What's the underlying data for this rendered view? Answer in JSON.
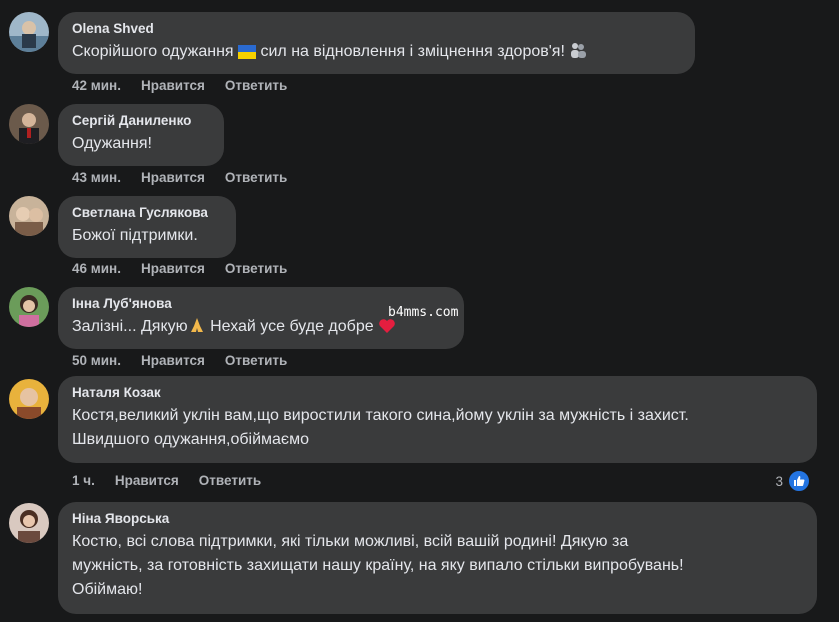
{
  "comments": [
    {
      "author": "Olena Shved",
      "text_a": "Скорійшого одужання ",
      "text_b": " сил на відновлення і зміцнення здоров'я! ",
      "time": "42 мин.",
      "like": "Нравится",
      "reply": "Ответить"
    },
    {
      "author": "Сергій Даниленко",
      "text": "Одужання!",
      "time": "43 мин.",
      "like": "Нравится",
      "reply": "Ответить"
    },
    {
      "author": "Светлана Гуслякова",
      "text": "Божої підтримки.",
      "time": "46 мин.",
      "like": "Нравится",
      "reply": "Ответить"
    },
    {
      "author": "Інна Луб'янова",
      "text_a": "Залізні... Дякую",
      "text_b": " Нехай усе буде добре ",
      "time": "50 мин.",
      "like": "Нравится",
      "reply": "Ответить"
    },
    {
      "author": "Наталя Козак",
      "text_line1": "Костя,великий уклін вам,що виростили такого сина,йому уклін за мужність і захист.",
      "text_line2": "Швидшого одужання,обіймаємо",
      "time": "1 ч.",
      "like": "Нравится",
      "reply": "Ответить",
      "reaction_count": "3"
    },
    {
      "author": "Ніна Яворська",
      "text_line1": "Костю, всі слова підтримки, які тільки можливі, всій вашій родині! Дякую за",
      "text_line2": "мужність, за готовність захищати нашу країну, на яку випало стільки випробувань!",
      "text_line3": "Обіймаю!"
    }
  ],
  "watermark": "b4mms.com",
  "colors": {
    "background": "#18191a",
    "bubble": "#3a3b3c",
    "like_blue": "#2374e1",
    "heart_red": "#e41e3f"
  }
}
